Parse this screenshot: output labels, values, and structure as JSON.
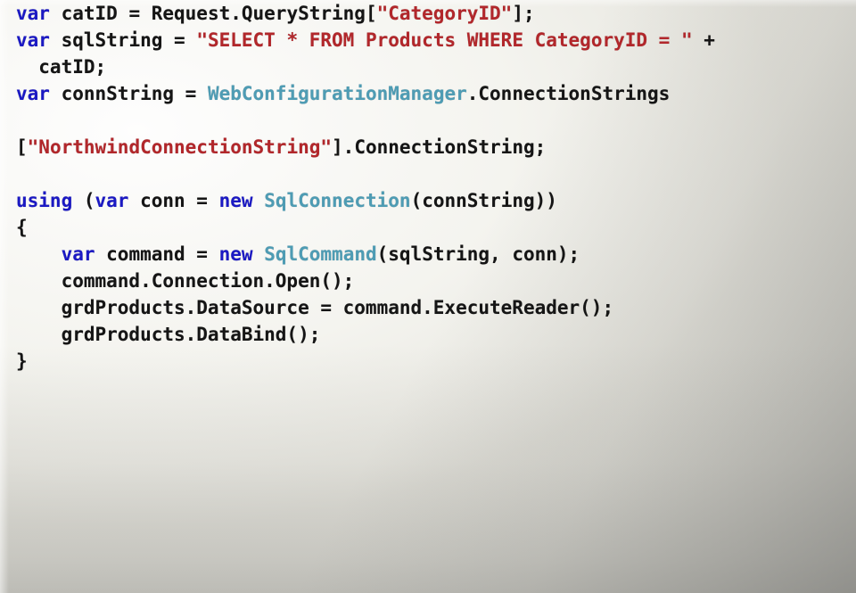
{
  "slide": {
    "background_color": "#e6e5de",
    "vignette_color": "#6c6c68",
    "language": "csharp"
  },
  "theme": {
    "keyword_color": "#1b19c4",
    "string_color": "#b2272b",
    "type_color": "#4e9cb4",
    "plain_color": "#151515"
  },
  "code": {
    "lines": [
      {
        "id": "line-1",
        "text": "var catID = Request.QueryString[\"CategoryID\"];",
        "tokens": [
          {
            "t": "var",
            "c": "kw"
          },
          {
            "t": " catID = Request.QueryString[",
            "c": "plain"
          },
          {
            "t": "\"CategoryID\"",
            "c": "str"
          },
          {
            "t": "];",
            "c": "plain"
          }
        ]
      },
      {
        "id": "line-2",
        "text": "var sqlString = \"SELECT * FROM Products WHERE CategoryID = \" +",
        "tokens": [
          {
            "t": "var",
            "c": "kw"
          },
          {
            "t": " sqlString = ",
            "c": "plain"
          },
          {
            "t": "\"SELECT * FROM Products WHERE CategoryID = \"",
            "c": "str"
          },
          {
            "t": " +",
            "c": "plain"
          }
        ]
      },
      {
        "id": "line-3",
        "text": "  catID;",
        "tokens": [
          {
            "t": "  catID;",
            "c": "plain"
          }
        ]
      },
      {
        "id": "line-4",
        "text": "var connString = WebConfigurationManager.ConnectionStrings",
        "tokens": [
          {
            "t": "var",
            "c": "kw"
          },
          {
            "t": " connString = ",
            "c": "plain"
          },
          {
            "t": "WebConfigurationManager",
            "c": "type"
          },
          {
            "t": ".ConnectionStrings",
            "c": "plain"
          }
        ]
      },
      {
        "id": "line-5",
        "text": "",
        "tokens": []
      },
      {
        "id": "line-6",
        "text": "[\"NorthwindConnectionString\"].ConnectionString;",
        "tokens": [
          {
            "t": "[",
            "c": "plain"
          },
          {
            "t": "\"NorthwindConnectionString\"",
            "c": "str"
          },
          {
            "t": "].ConnectionString;",
            "c": "plain"
          }
        ]
      },
      {
        "id": "line-7",
        "text": "",
        "tokens": []
      },
      {
        "id": "line-8",
        "text": "using (var conn = new SqlConnection(connString))",
        "tokens": [
          {
            "t": "using",
            "c": "kw"
          },
          {
            "t": " (",
            "c": "plain"
          },
          {
            "t": "var",
            "c": "kw"
          },
          {
            "t": " conn = ",
            "c": "plain"
          },
          {
            "t": "new",
            "c": "kw"
          },
          {
            "t": " ",
            "c": "plain"
          },
          {
            "t": "SqlConnection",
            "c": "type"
          },
          {
            "t": "(connString))",
            "c": "plain"
          }
        ]
      },
      {
        "id": "line-9",
        "text": "{",
        "tokens": [
          {
            "t": "{",
            "c": "plain"
          }
        ]
      },
      {
        "id": "line-10",
        "text": "    var command = new SqlCommand(sqlString, conn);",
        "tokens": [
          {
            "t": "    ",
            "c": "plain"
          },
          {
            "t": "var",
            "c": "kw"
          },
          {
            "t": " command = ",
            "c": "plain"
          },
          {
            "t": "new",
            "c": "kw"
          },
          {
            "t": " ",
            "c": "plain"
          },
          {
            "t": "SqlCommand",
            "c": "type"
          },
          {
            "t": "(sqlString, conn);",
            "c": "plain"
          }
        ]
      },
      {
        "id": "line-11",
        "text": "    command.Connection.Open();",
        "tokens": [
          {
            "t": "    command.Connection.Open();",
            "c": "plain"
          }
        ]
      },
      {
        "id": "line-12",
        "text": "    grdProducts.DataSource = command.ExecuteReader();",
        "tokens": [
          {
            "t": "    grdProducts.DataSource = command.ExecuteReader();",
            "c": "plain"
          }
        ]
      },
      {
        "id": "line-13",
        "text": "    grdProducts.DataBind();",
        "tokens": [
          {
            "t": "    grdProducts.DataBind();",
            "c": "plain"
          }
        ]
      },
      {
        "id": "line-14",
        "text": "}",
        "tokens": [
          {
            "t": "}",
            "c": "plain"
          }
        ]
      }
    ]
  }
}
